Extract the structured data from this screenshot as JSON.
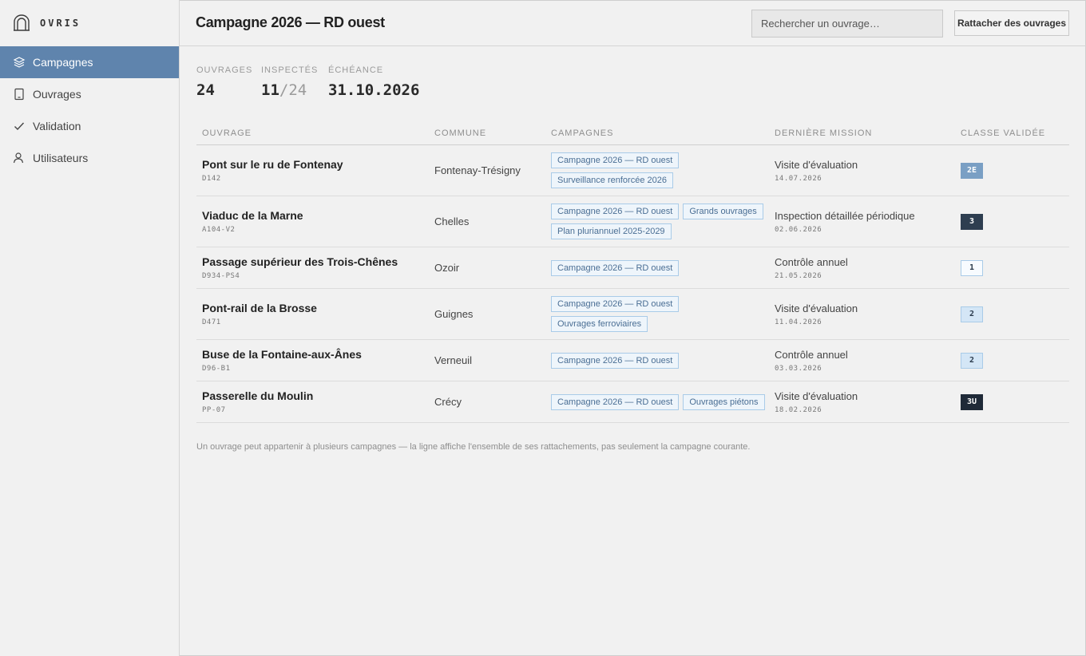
{
  "app": {
    "name": "OVRIS"
  },
  "sidebar": {
    "items": [
      {
        "label": "Campagnes",
        "icon": "layers-icon",
        "active": true
      },
      {
        "label": "Ouvrages",
        "icon": "tablet-icon",
        "active": false
      },
      {
        "label": "Validation",
        "icon": "check-icon",
        "active": false
      },
      {
        "label": "Utilisateurs",
        "icon": "user-icon",
        "active": false
      }
    ]
  },
  "header": {
    "title": "Campagne 2026 — RD ouest",
    "search_placeholder": "Rechercher un ouvrage…",
    "attach_button": "Rattacher des ouvrages"
  },
  "stats": {
    "ouvrages_label": "Ouvrages",
    "ouvrages_value": "24",
    "inspectes_label": "Inspectés",
    "inspectes_value": "11",
    "inspectes_total": "/24",
    "echeance_label": "Échéance",
    "echeance_value": "31.10.2026"
  },
  "table": {
    "headers": [
      "Ouvrage",
      "Commune",
      "Campagnes",
      "Dernière mission",
      "Classe validée"
    ],
    "rows": [
      {
        "name": "Pont sur le ru de Fontenay",
        "code": "D142",
        "commune": "Fontenay-Trésigny",
        "campagnes": [
          "Campagne 2026 — RD ouest",
          "Surveillance renforcée 2026"
        ],
        "mission": "Visite d'évaluation",
        "date": "14.07.2026",
        "classe": "2E",
        "style": "b-mid"
      },
      {
        "name": "Viaduc de la Marne",
        "code": "A104-V2",
        "commune": "Chelles",
        "campagnes": [
          "Campagne 2026 — RD ouest",
          "Grands ouvrages",
          "Plan pluriannuel 2025-2029"
        ],
        "mission": "Inspection détaillée périodique",
        "date": "02.06.2026",
        "classe": "3",
        "style": "b-dark"
      },
      {
        "name": "Passage supérieur des Trois-Chênes",
        "code": "D934-PS4",
        "commune": "Ozoir",
        "campagnes": [
          "Campagne 2026 — RD ouest"
        ],
        "mission": "Contrôle annuel",
        "date": "21.05.2026",
        "classe": "1",
        "style": "b-light"
      },
      {
        "name": "Pont-rail de la Brosse",
        "code": "D471",
        "commune": "Guignes",
        "campagnes": [
          "Campagne 2026 — RD ouest",
          "Ouvrages ferroviaires"
        ],
        "mission": "Visite d'évaluation",
        "date": "11.04.2026",
        "classe": "2",
        "style": "b-blue"
      },
      {
        "name": "Buse de la Fontaine-aux-Ânes",
        "code": "D96-B1",
        "commune": "Verneuil",
        "campagnes": [
          "Campagne 2026 — RD ouest"
        ],
        "mission": "Contrôle annuel",
        "date": "03.03.2026",
        "classe": "2",
        "style": "b-blue"
      },
      {
        "name": "Passerelle du Moulin",
        "code": "PP-07",
        "commune": "Crécy",
        "campagnes": [
          "Campagne 2026 — RD ouest",
          "Ouvrages piétons"
        ],
        "mission": "Visite d'évaluation",
        "date": "18.02.2026",
        "classe": "3U",
        "style": "b-darkest"
      }
    ]
  },
  "footnote": "Un ouvrage peut appartenir à plusieurs campagnes — la ligne affiche l'ensemble de ses rattachements, pas seulement la campagne courante.",
  "colors": {
    "accent": "#5f84ad",
    "tag_border": "#a9cbe8",
    "tag_text": "#4a6e94"
  }
}
